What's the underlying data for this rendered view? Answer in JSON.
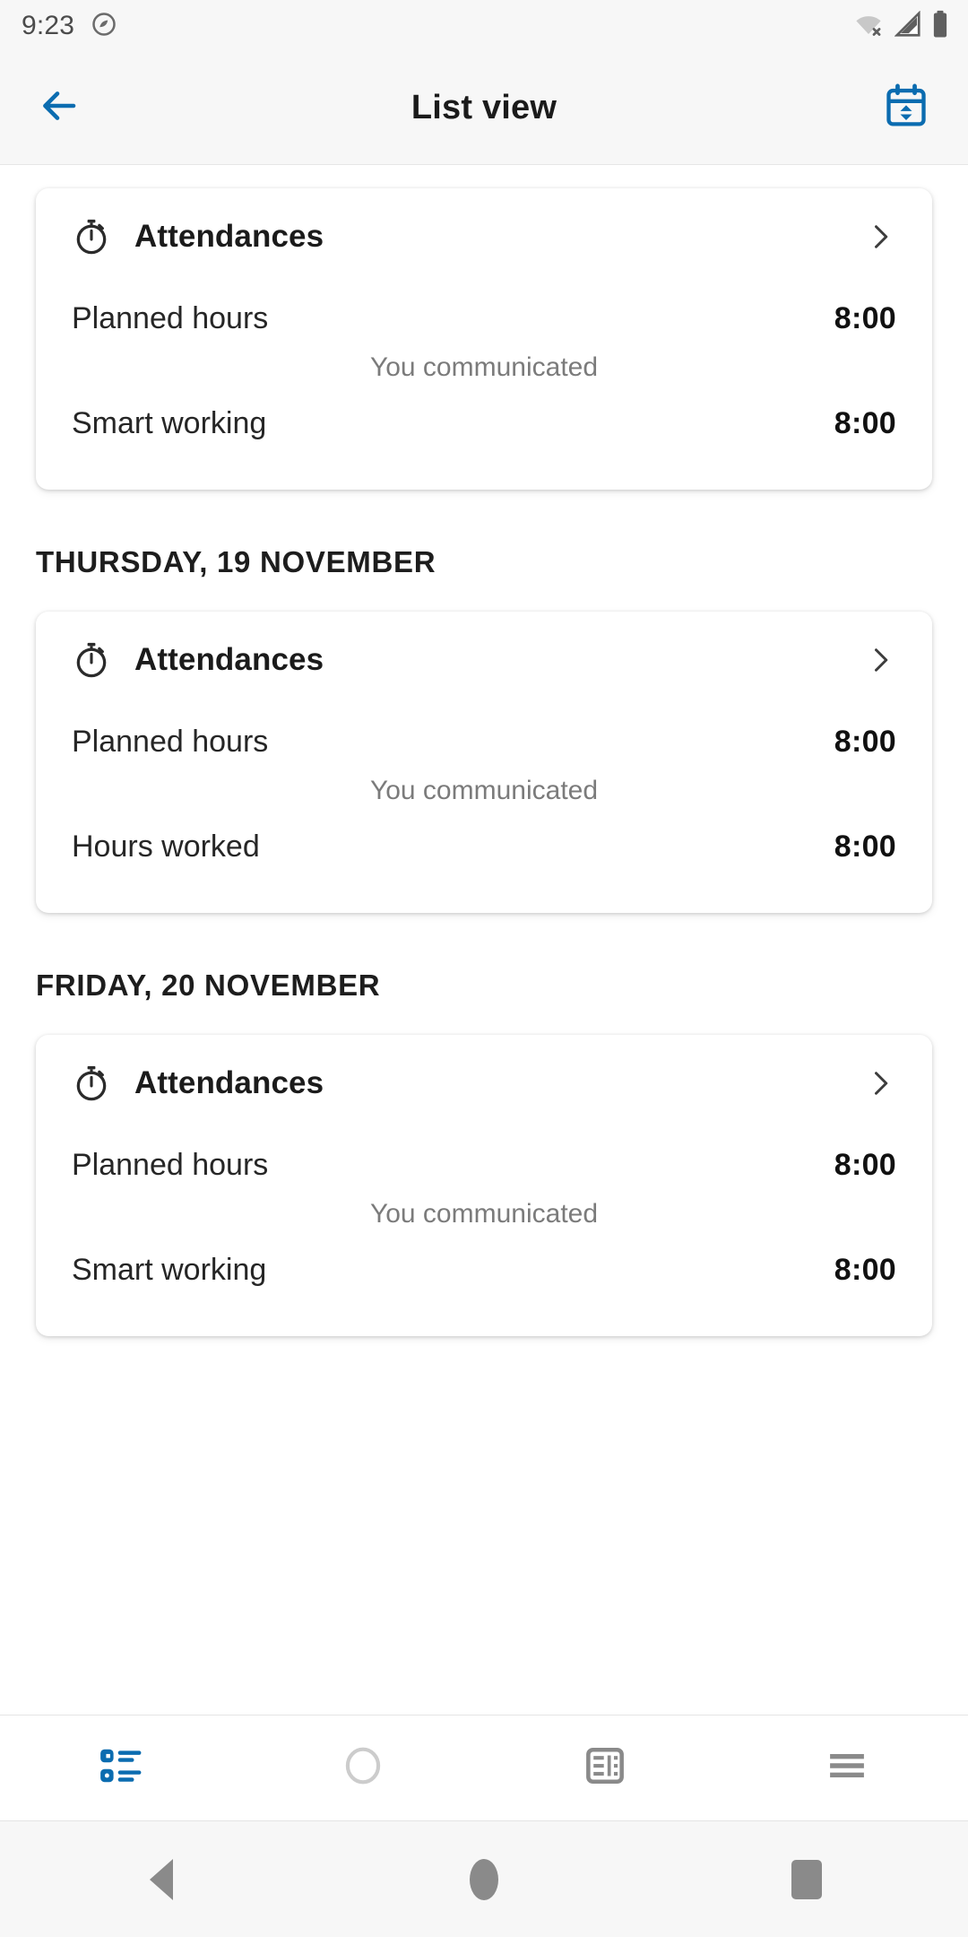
{
  "status_bar": {
    "time": "9:23",
    "icons": [
      "dnd-icon",
      "wifi-off-icon",
      "cellular-signal-icon",
      "battery-icon"
    ]
  },
  "app_bar": {
    "back_icon": "arrow-left-icon",
    "title": "List view",
    "action_icon": "calendar-switch-icon"
  },
  "colors": {
    "accent": "#0b6cb0",
    "screen_bg": "#ffffff",
    "chrome_bg": "#f7f7f7",
    "text_primary": "#1b1b1b",
    "text_muted": "#7b7b7b",
    "icon_inactive": "#8a8a8a"
  },
  "sections": [
    {
      "day_header": "",
      "card": {
        "icon": "stopwatch-icon",
        "title": "Attendances",
        "chevron": "chevron-right-icon",
        "rows": [
          {
            "label": "Planned hours",
            "value": "8:00"
          }
        ],
        "note": "You communicated",
        "rows_after": [
          {
            "label": "Smart working",
            "value": "8:00"
          }
        ]
      }
    },
    {
      "day_header": "THURSDAY, 19 NOVEMBER",
      "card": {
        "icon": "stopwatch-icon",
        "title": "Attendances",
        "chevron": "chevron-right-icon",
        "rows": [
          {
            "label": "Planned hours",
            "value": "8:00"
          }
        ],
        "note": "You communicated",
        "rows_after": [
          {
            "label": "Hours worked",
            "value": "8:00"
          }
        ]
      }
    },
    {
      "day_header": "FRIDAY, 20 NOVEMBER",
      "card": {
        "icon": "stopwatch-icon",
        "title": "Attendances",
        "chevron": "chevron-right-icon",
        "rows": [
          {
            "label": "Planned hours",
            "value": "8:00"
          }
        ],
        "note": "You communicated",
        "rows_after": [
          {
            "label": "Smart working",
            "value": "8:00"
          }
        ]
      }
    }
  ],
  "tab_bar": {
    "items": [
      {
        "icon": "list-view-icon",
        "active": true
      },
      {
        "icon": "circle-outline-icon",
        "active": false
      },
      {
        "icon": "dashboard-grid-icon",
        "active": false
      },
      {
        "icon": "hamburger-menu-icon",
        "active": false
      }
    ]
  },
  "android_nav": {
    "items": [
      "back-button",
      "home-button",
      "recents-button"
    ]
  }
}
